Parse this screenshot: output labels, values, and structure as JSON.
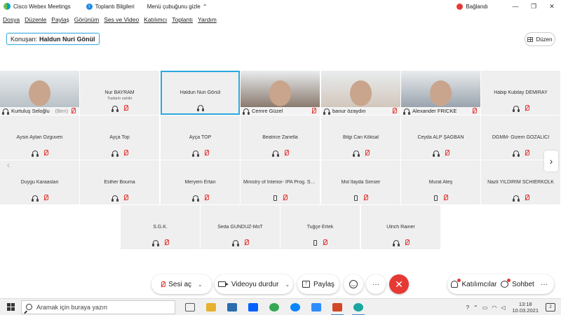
{
  "titlebar": {
    "app_name": "Cisco Webex Meetings",
    "meeting_info": "Toplantı Bilgileri",
    "hide_menu": "Menü çubuğunu gizle",
    "connection_status": "Bağlandı",
    "minimize": "—",
    "restore": "❐",
    "close": "✕"
  },
  "menu": [
    "Dosya",
    "Düzenle",
    "Paylaş",
    "Görünüm",
    "Ses ve Video",
    "Katılımcı",
    "Toplantı",
    "Yardım"
  ],
  "speaker": {
    "label": "Konuşan:",
    "name": "Haldun Nuri Gönül"
  },
  "layout_button": "Düzen",
  "tiles": [
    {
      "name": "Kurtuluş Seloğlu",
      "tag": "(Ben)",
      "type": "video",
      "photo": "#b9c2c8"
    },
    {
      "name": "Nur BAYRAM",
      "sub": "Toplantı sahibi",
      "type": "headset"
    },
    {
      "name": "Haldun Nuri Gönül",
      "type": "active"
    },
    {
      "name": "Cemre Güzel",
      "type": "video",
      "photo": "#8a7a6e"
    },
    {
      "name": "banur özaydın",
      "type": "video",
      "photo": "#d2c7bd"
    },
    {
      "name": "Alexander FRICKE",
      "type": "video",
      "photo": "#9aa4ae"
    },
    {
      "name": "Habip Kubilay DEMİRAY",
      "type": "headset"
    },
    {
      "name": "Aysin Aylan Ozguven",
      "type": "headset"
    },
    {
      "name": "Ayça Top",
      "type": "headset"
    },
    {
      "name": "Ayça TOP",
      "type": "headset"
    },
    {
      "name": "Beatrice Zanella",
      "type": "headset"
    },
    {
      "name": "Bilgi Can Köksal",
      "type": "headset"
    },
    {
      "name": "Ceyda ALP ŞAĞBAN",
      "type": "headset"
    },
    {
      "name": "DGMM- Gizem GÖZALICI",
      "type": "headset"
    },
    {
      "name": "Duygu Karaaslan",
      "type": "headset"
    },
    {
      "name": "Esther Bouma",
      "type": "headset"
    },
    {
      "name": "Meryem Ertan",
      "type": "headset"
    },
    {
      "name": "Ministry of Interior- IPA Prog. Se...",
      "type": "phone"
    },
    {
      "name": "Mol Ilayda Simser",
      "type": "phone"
    },
    {
      "name": "Murat Ateş",
      "type": "phone"
    },
    {
      "name": "Nazli YILDIRIM SCHIERKOLK",
      "type": "headset"
    },
    {
      "name": "S.G.K.",
      "type": "headset"
    },
    {
      "name": "Seda GÜNDÜZ-MoT",
      "type": "headset"
    },
    {
      "name": "Tuğçe Ertek",
      "type": "phone"
    },
    {
      "name": "Ulrich Rainer",
      "type": "headset"
    }
  ],
  "controls": {
    "audio": "Sesi aç",
    "video": "Videoyu durdur",
    "share": "Paylaş",
    "more": "···",
    "end": "✕",
    "participants": "Katılımcılar",
    "chat": "Sohbet",
    "panel_more": "···",
    "caret": "⌄"
  },
  "taskbar": {
    "search_placeholder": "Aramak için buraya yazın",
    "apps": [
      "#5b5b5b",
      "#e6b12e",
      "#2b6cb0",
      "#0061fe",
      "#34a853",
      "#0a84ff",
      "#2d8cff",
      "#d24726",
      "#1aa7a0"
    ],
    "time": "13:18",
    "date": "10.03.2021",
    "notif_count": "2"
  }
}
